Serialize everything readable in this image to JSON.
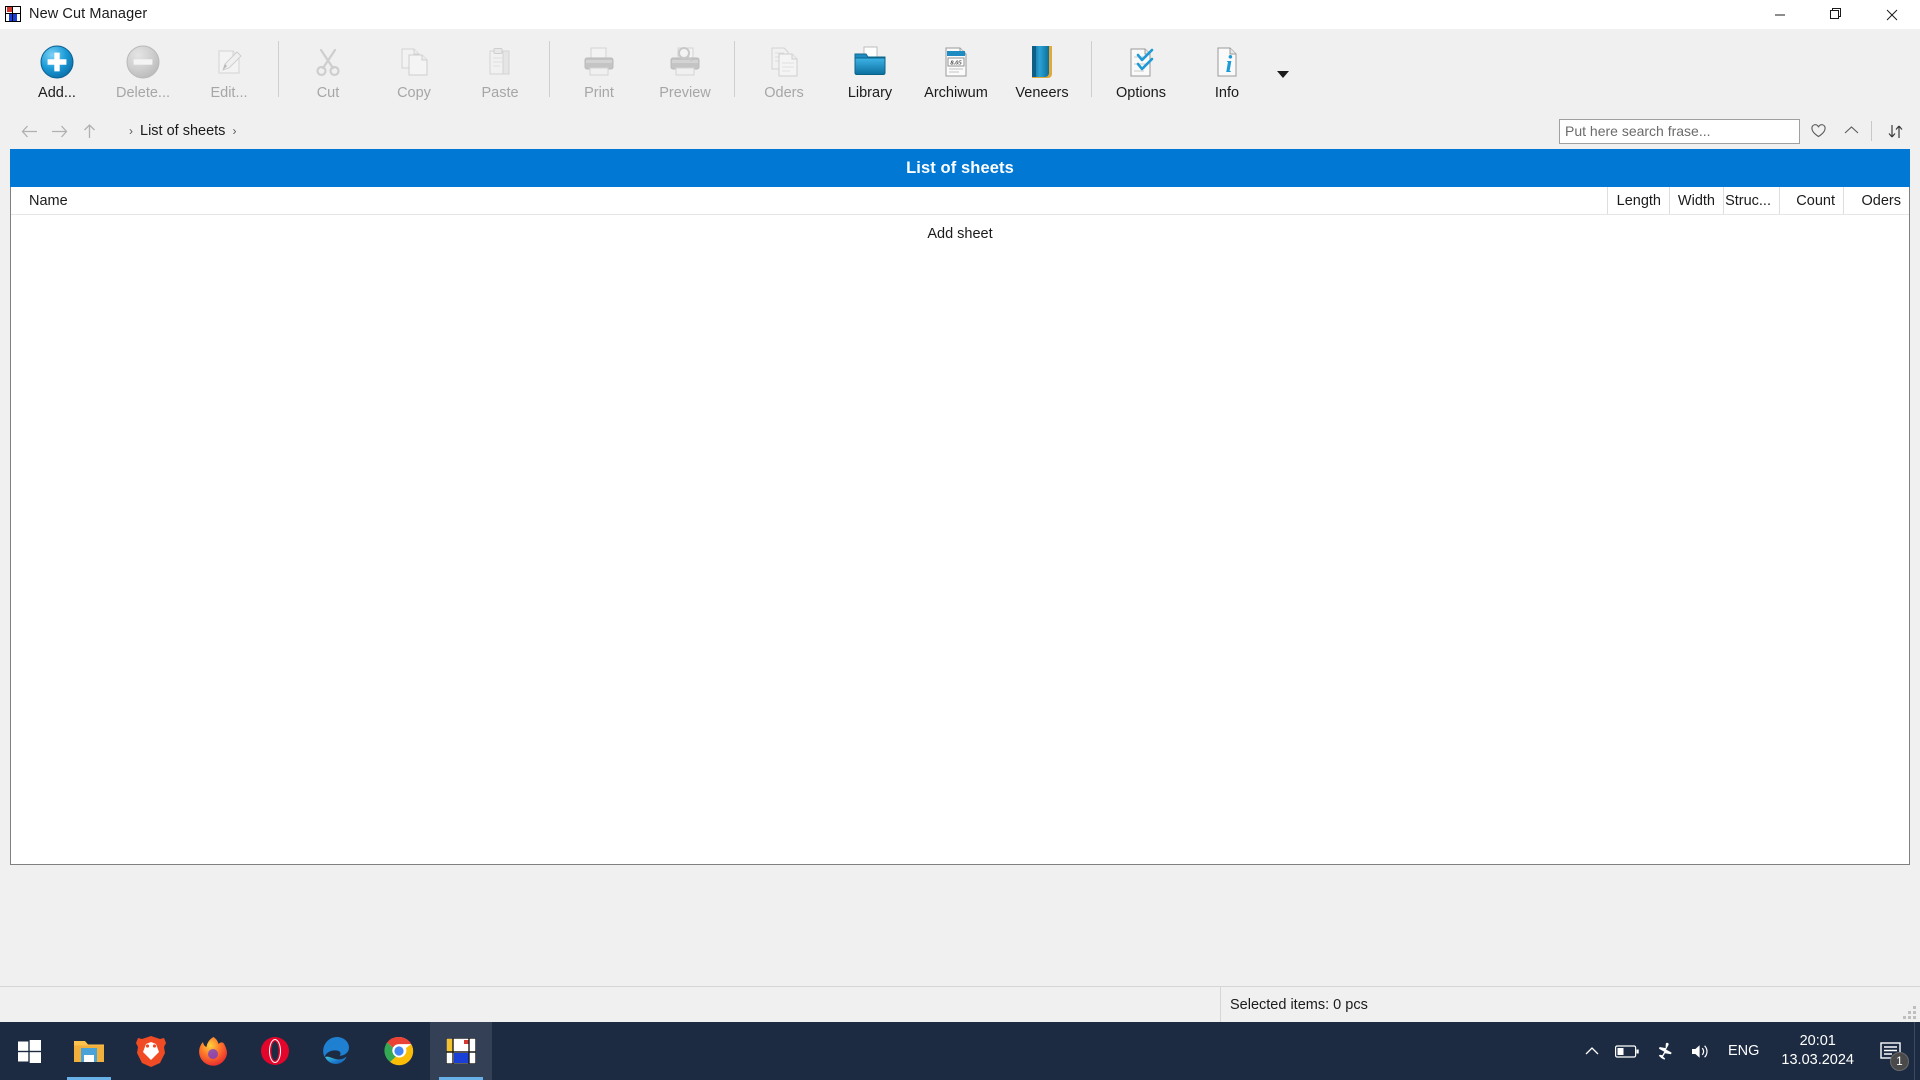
{
  "window": {
    "title": "New Cut Manager",
    "icon": "app-logo-icon",
    "controls": {
      "minimize": "—",
      "maximize": "❐",
      "close": "✕"
    }
  },
  "toolbar": {
    "groups": [
      {
        "items": [
          {
            "id": "add",
            "label": "Add...",
            "icon": "plus-circle-icon",
            "enabled": true
          },
          {
            "id": "delete",
            "label": "Delete...",
            "icon": "minus-circle-icon",
            "enabled": false
          },
          {
            "id": "edit",
            "label": "Edit...",
            "icon": "pencil-page-icon",
            "enabled": false
          }
        ]
      },
      {
        "items": [
          {
            "id": "cut",
            "label": "Cut",
            "icon": "scissors-icon",
            "enabled": false
          },
          {
            "id": "copy",
            "label": "Copy",
            "icon": "copy-pages-icon",
            "enabled": false
          },
          {
            "id": "paste",
            "label": "Paste",
            "icon": "clipboard-icon",
            "enabled": false
          }
        ]
      },
      {
        "items": [
          {
            "id": "print",
            "label": "Print",
            "icon": "printer-icon",
            "enabled": false
          },
          {
            "id": "preview",
            "label": "Preview",
            "icon": "print-preview-icon",
            "enabled": false
          }
        ]
      },
      {
        "items": [
          {
            "id": "oders",
            "label": "Oders",
            "icon": "documents-icon",
            "enabled": false
          },
          {
            "id": "library",
            "label": "Library",
            "icon": "folder-open-icon",
            "enabled": true
          },
          {
            "id": "archiwum",
            "label": "Archiwum",
            "icon": "archive-box-icon",
            "enabled": true
          },
          {
            "id": "veneers",
            "label": "Veneers",
            "icon": "veneer-book-icon",
            "enabled": true
          }
        ]
      },
      {
        "items": [
          {
            "id": "options",
            "label": "Options",
            "icon": "checklist-icon",
            "enabled": true
          },
          {
            "id": "info",
            "label": "Info",
            "icon": "info-page-icon",
            "enabled": true
          }
        ]
      }
    ],
    "overflow_icon": "chevron-down-icon"
  },
  "addressbar": {
    "back_icon": "arrow-left-icon",
    "forward_icon": "arrow-right-icon",
    "up_icon": "arrow-up-icon",
    "separator": "›",
    "crumb": "List of sheets",
    "search": {
      "placeholder": "Put here search frase...",
      "value": ""
    },
    "favorite_icon": "heart-icon",
    "collapse_icon": "chevron-up-icon",
    "sort_icon": "sort-arrows-icon"
  },
  "panel": {
    "title": "List of sheets",
    "accent_color": "#0078d4",
    "columns": [
      {
        "key": "name",
        "label": "Name",
        "align": "left"
      },
      {
        "key": "length",
        "label": "Length",
        "align": "right"
      },
      {
        "key": "width",
        "label": "Width",
        "align": "right"
      },
      {
        "key": "struct",
        "label": "Struc...",
        "align": "right"
      },
      {
        "key": "count",
        "label": "Count",
        "align": "right"
      },
      {
        "key": "oders",
        "label": "Oders",
        "align": "right"
      }
    ],
    "rows": [],
    "empty_action": "Add sheet"
  },
  "statusbar": {
    "selected_text": "Selected items: 0 pcs",
    "grip_icon": "resize-grip-icon"
  },
  "taskbar": {
    "start_icon": "windows-start-icon",
    "items": [
      {
        "id": "explorer",
        "icon": "file-explorer-icon",
        "active": false,
        "running": true
      },
      {
        "id": "brave",
        "icon": "brave-browser-icon",
        "active": false,
        "running": false
      },
      {
        "id": "firefox",
        "icon": "firefox-icon",
        "active": false,
        "running": false
      },
      {
        "id": "opera",
        "icon": "opera-icon",
        "active": false,
        "running": false
      },
      {
        "id": "edge",
        "icon": "microsoft-edge-icon",
        "active": false,
        "running": false
      },
      {
        "id": "chrome",
        "icon": "google-chrome-icon",
        "active": false,
        "running": false
      },
      {
        "id": "cutmgr",
        "icon": "cut-manager-icon",
        "active": true,
        "running": true
      }
    ],
    "tray": {
      "overflow_icon": "chevron-up-icon",
      "battery_icon": "battery-icon",
      "airplane_icon": "airplane-mode-icon",
      "volume_icon": "speaker-icon",
      "language": "ENG",
      "time": "20:01",
      "date": "13.03.2024",
      "notification_icon": "action-center-icon",
      "notification_count": "1"
    }
  }
}
